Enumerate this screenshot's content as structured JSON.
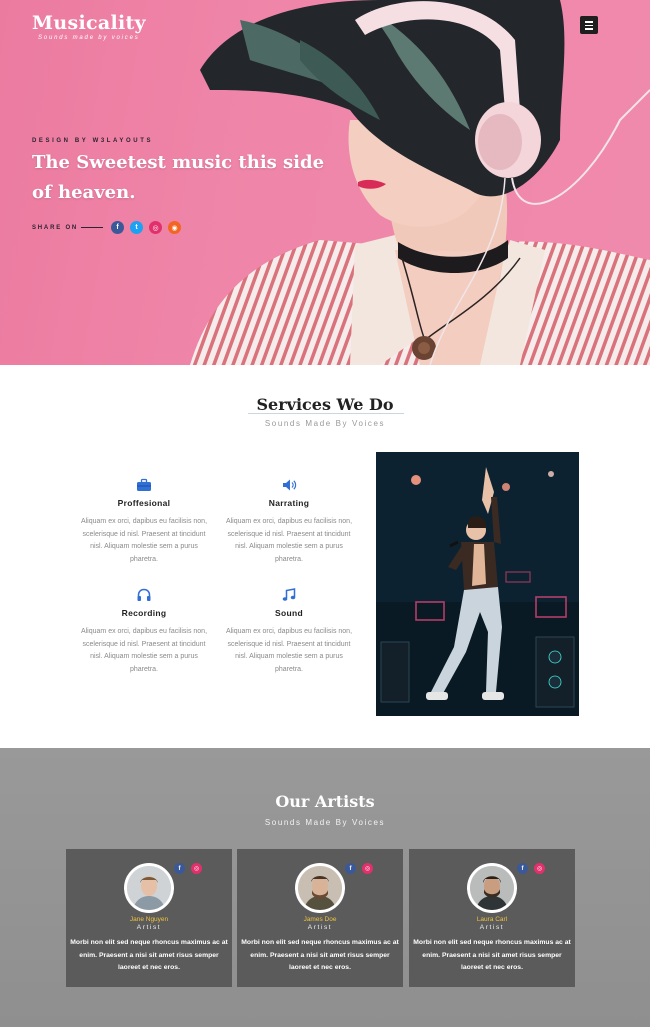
{
  "brand": {
    "title": "Musicality",
    "tagline": "Sounds made by voices"
  },
  "hero": {
    "eyebrow": "DESIGN BY W3LAYOUTS",
    "headline": "The Sweetest music this side of heaven.",
    "share_label": "SHARE ON",
    "social": [
      {
        "icon": "facebook-icon",
        "glyph": "f",
        "color": "#3b5998"
      },
      {
        "icon": "twitter-icon",
        "glyph": "t",
        "color": "#1da1f2"
      },
      {
        "icon": "instagram-icon",
        "glyph": "◎",
        "color": "#e1306c"
      },
      {
        "icon": "rss-icon",
        "glyph": "◉",
        "color": "#f26522"
      }
    ]
  },
  "services": {
    "title": "Services We Do",
    "subtitle": "Sounds Made By Voices",
    "items": [
      {
        "icon": "briefcase-icon",
        "name": "Proffesional",
        "text": "Aliquam ex orci, dapibus eu facilisis non, scelerisque id nisl. Praesent at tincidunt nisl. Aliquam molestie sem a purus pharetra."
      },
      {
        "icon": "speaker-icon",
        "name": "Narrating",
        "text": "Aliquam ex orci, dapibus eu facilisis non, scelerisque id nisl. Praesent at tincidunt nisl. Aliquam molestie sem a purus pharetra."
      },
      {
        "icon": "headphones-icon",
        "name": "Recording",
        "text": "Aliquam ex orci, dapibus eu facilisis non, scelerisque id nisl. Praesent at tincidunt nisl. Aliquam molestie sem a purus pharetra."
      },
      {
        "icon": "music-note-icon",
        "name": "Sound",
        "text": "Aliquam ex orci, dapibus eu facilisis non, scelerisque id nisl. Praesent at tincidunt nisl. Aliquam molestie sem a purus pharetra."
      }
    ]
  },
  "artists": {
    "title": "Our Artists",
    "subtitle": "Sounds Made By Voices",
    "cards": [
      {
        "name": "Jane Nguyen",
        "role": "Artist",
        "text": "Morbi non elit sed neque rhoncus maximus ac at enim. Praesent a nisi sit amet risus semper laoreet et nec eros."
      },
      {
        "name": "James Doe",
        "role": "Artist",
        "text": "Morbi non elit sed neque rhoncus maximus ac at enim. Praesent a nisi sit amet risus semper laoreet et nec eros."
      },
      {
        "name": "Laura Carl",
        "role": "Artist",
        "text": "Morbi non elit sed neque rhoncus maximus ac at enim. Praesent a nisi sit amet risus semper laoreet et nec eros."
      }
    ],
    "card_social": [
      {
        "icon": "facebook-icon",
        "glyph": "f",
        "color": "#3b5998"
      },
      {
        "icon": "dribbble-icon",
        "glyph": "◎",
        "color": "#e1306c"
      }
    ]
  },
  "colors": {
    "hero_pink": "#ef86a9",
    "accent_gold": "#f0c33c",
    "card_bg": "#5b5b5b",
    "icon_blue": "#2f6fd6"
  }
}
